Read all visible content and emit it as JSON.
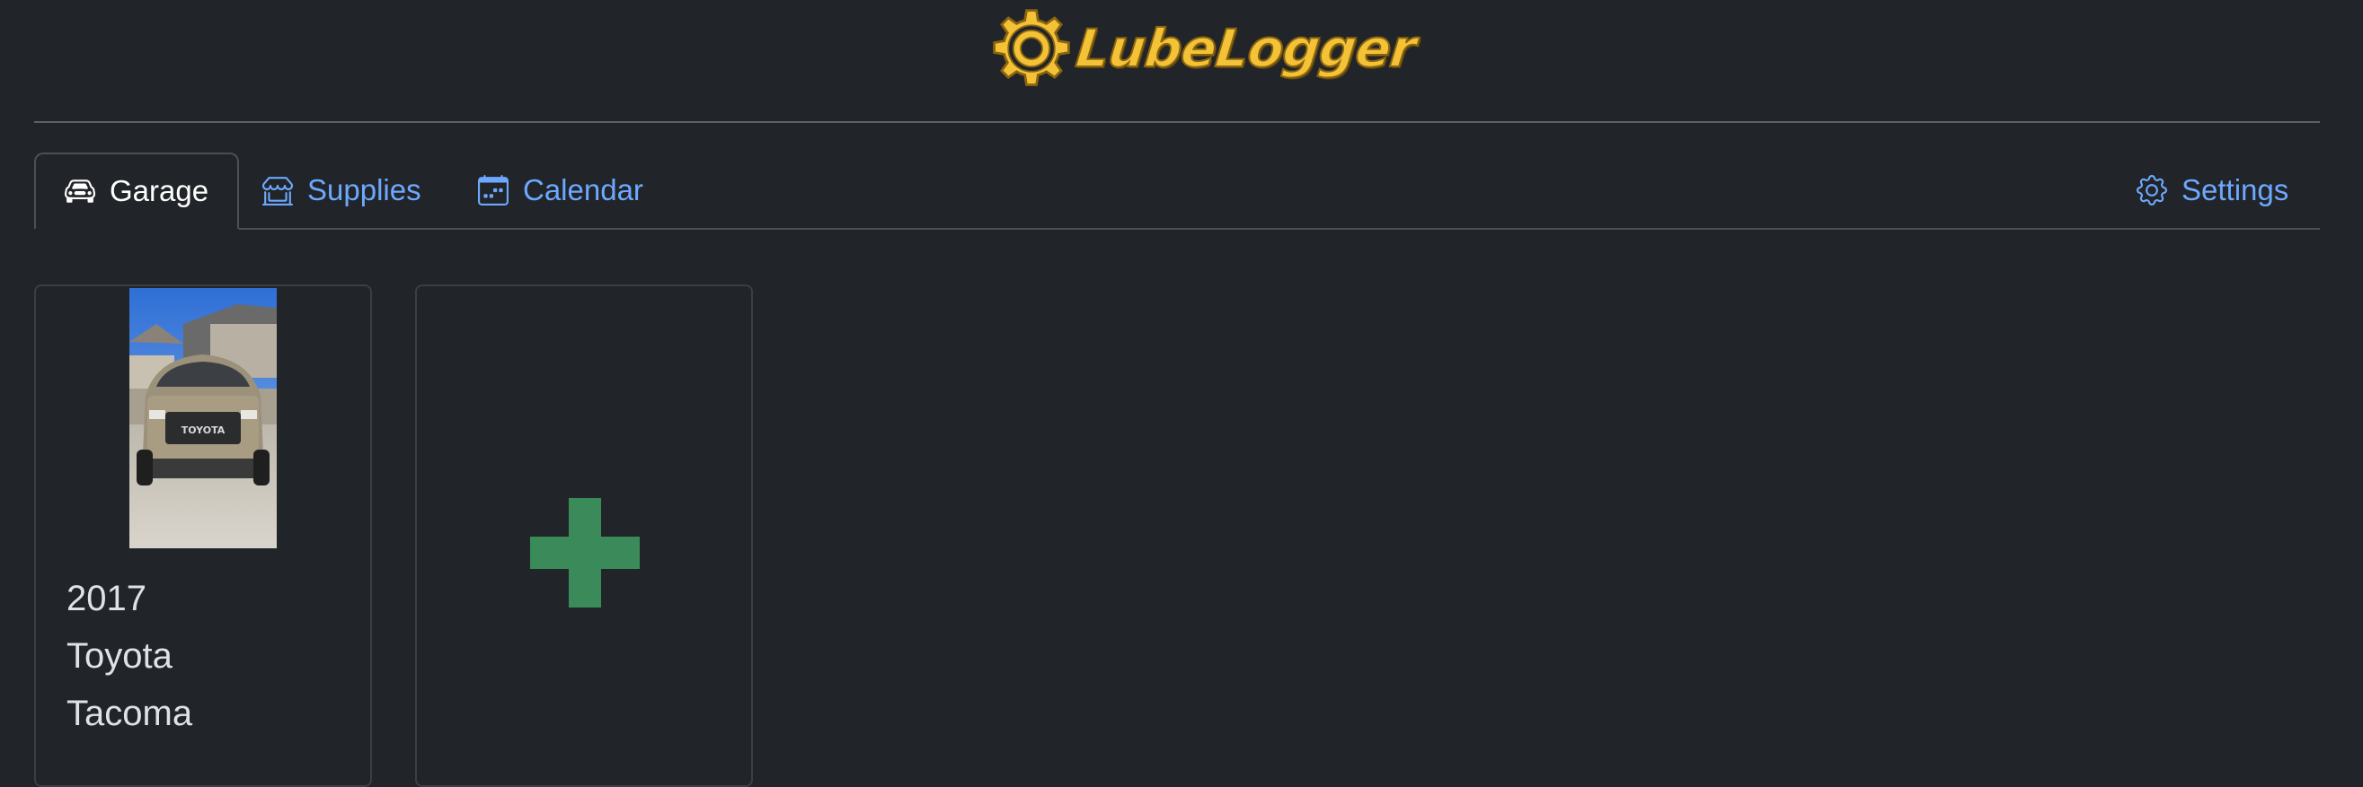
{
  "brand": {
    "name": "LubeLogger",
    "logo_icon": "gear-icon",
    "logo_color": "#f3c236"
  },
  "tabs": [
    {
      "label": "Garage",
      "icon": "car-icon",
      "active": true
    },
    {
      "label": "Supplies",
      "icon": "store-icon",
      "active": false
    },
    {
      "label": "Calendar",
      "icon": "calendar-icon",
      "active": false
    },
    {
      "label": "Settings",
      "icon": "gear-icon",
      "active": false
    }
  ],
  "vehicles": [
    {
      "year": "2017",
      "make": "Toyota",
      "model": "Tacoma",
      "photo": "vehicle-photo"
    }
  ],
  "add_vehicle": {
    "icon": "plus-icon",
    "color": "#3a8a5a"
  },
  "colors": {
    "background": "#212529",
    "link": "#6ea8fe",
    "border": "#495057"
  }
}
